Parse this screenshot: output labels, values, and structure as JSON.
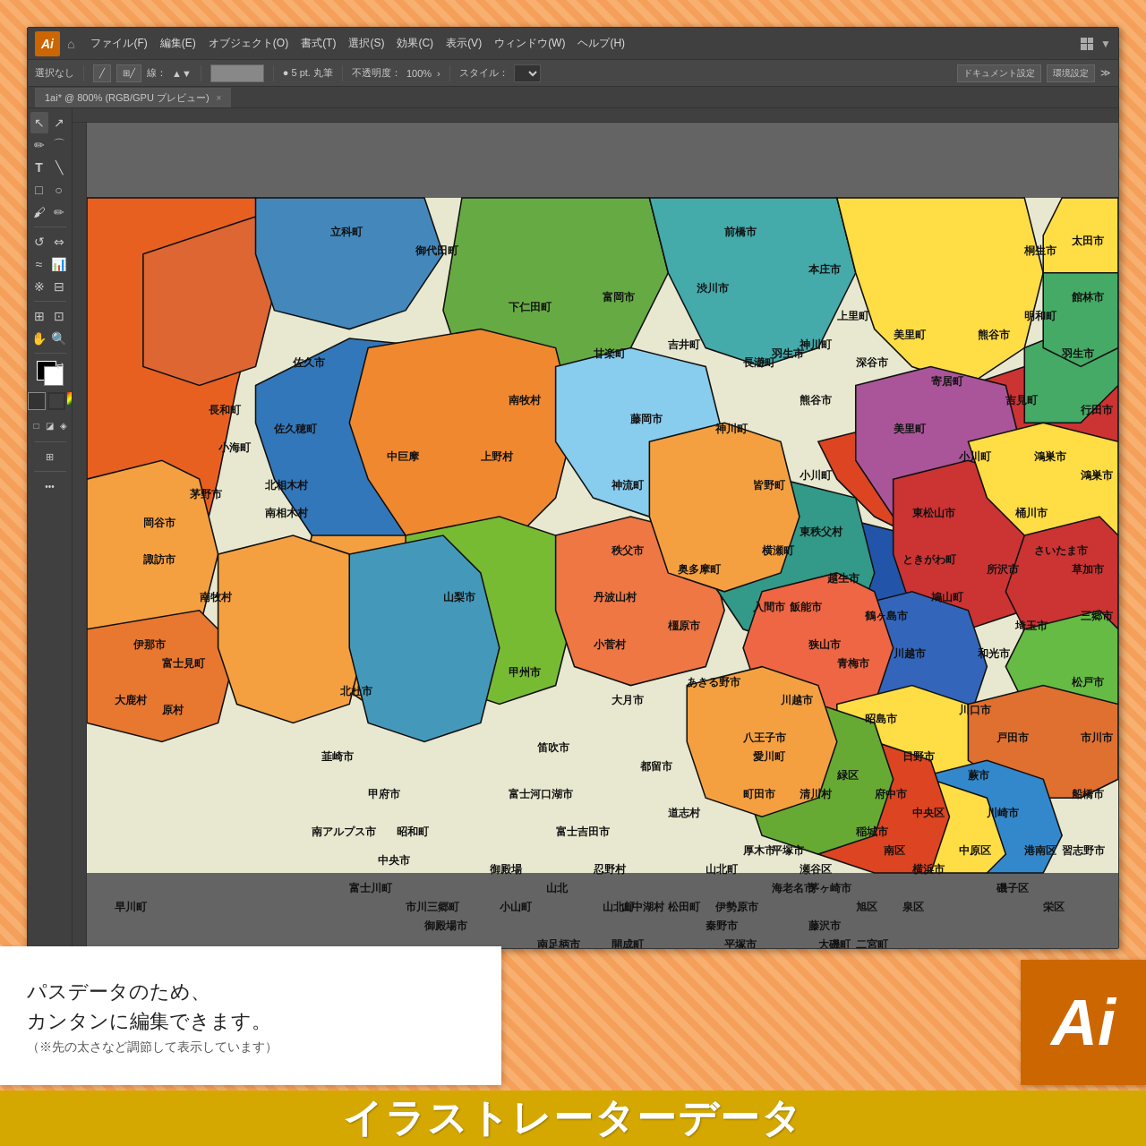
{
  "app": {
    "logo": "Ai",
    "title": "1ai* @ 800% (RGB/GPU プレビュー)",
    "tab_close": "×"
  },
  "menu": {
    "items": [
      "ファイル(F)",
      "編集(E)",
      "オブジェクト(O)",
      "書式(T)",
      "選択(S)",
      "効果(C)",
      "表示(V)",
      "ウィンドウ(W)",
      "ヘルプ(H)"
    ]
  },
  "options_bar": {
    "selection_label": "選択なし",
    "stroke_label": "線：",
    "stroke_unit": "▲▼",
    "pen_size": "● 5 pt. 丸筆",
    "opacity_label": "不透明度：",
    "opacity_value": "100%",
    "style_label": "スタイル：",
    "doc_settings": "ドキュメント設定",
    "env_settings": "環境設定"
  },
  "description": {
    "line1": "パスデータのため、",
    "line2": "カンタンに編集できます。",
    "sub": "（※先の太さなど調節して表示しています）"
  },
  "banner": {
    "text": "イラストレーターデータ"
  },
  "ai_logo": {
    "text": "Ai"
  },
  "colors": {
    "orange_light": "#F5A35A",
    "orange_mid": "#E8863A",
    "blue_dark": "#2266AA",
    "blue_mid": "#4499CC",
    "green_dark": "#336633",
    "green_light": "#88BB44",
    "yellow": "#FFDD44",
    "red": "#CC3333",
    "teal": "#338899",
    "purple": "#886699",
    "brown": "#AA6633",
    "lime": "#AACC33",
    "coral": "#EE6644",
    "gold": "#D4A800",
    "ai_bg": "#CC6600"
  },
  "map_regions": {
    "title": "Kanto and surroundings Japan map"
  }
}
